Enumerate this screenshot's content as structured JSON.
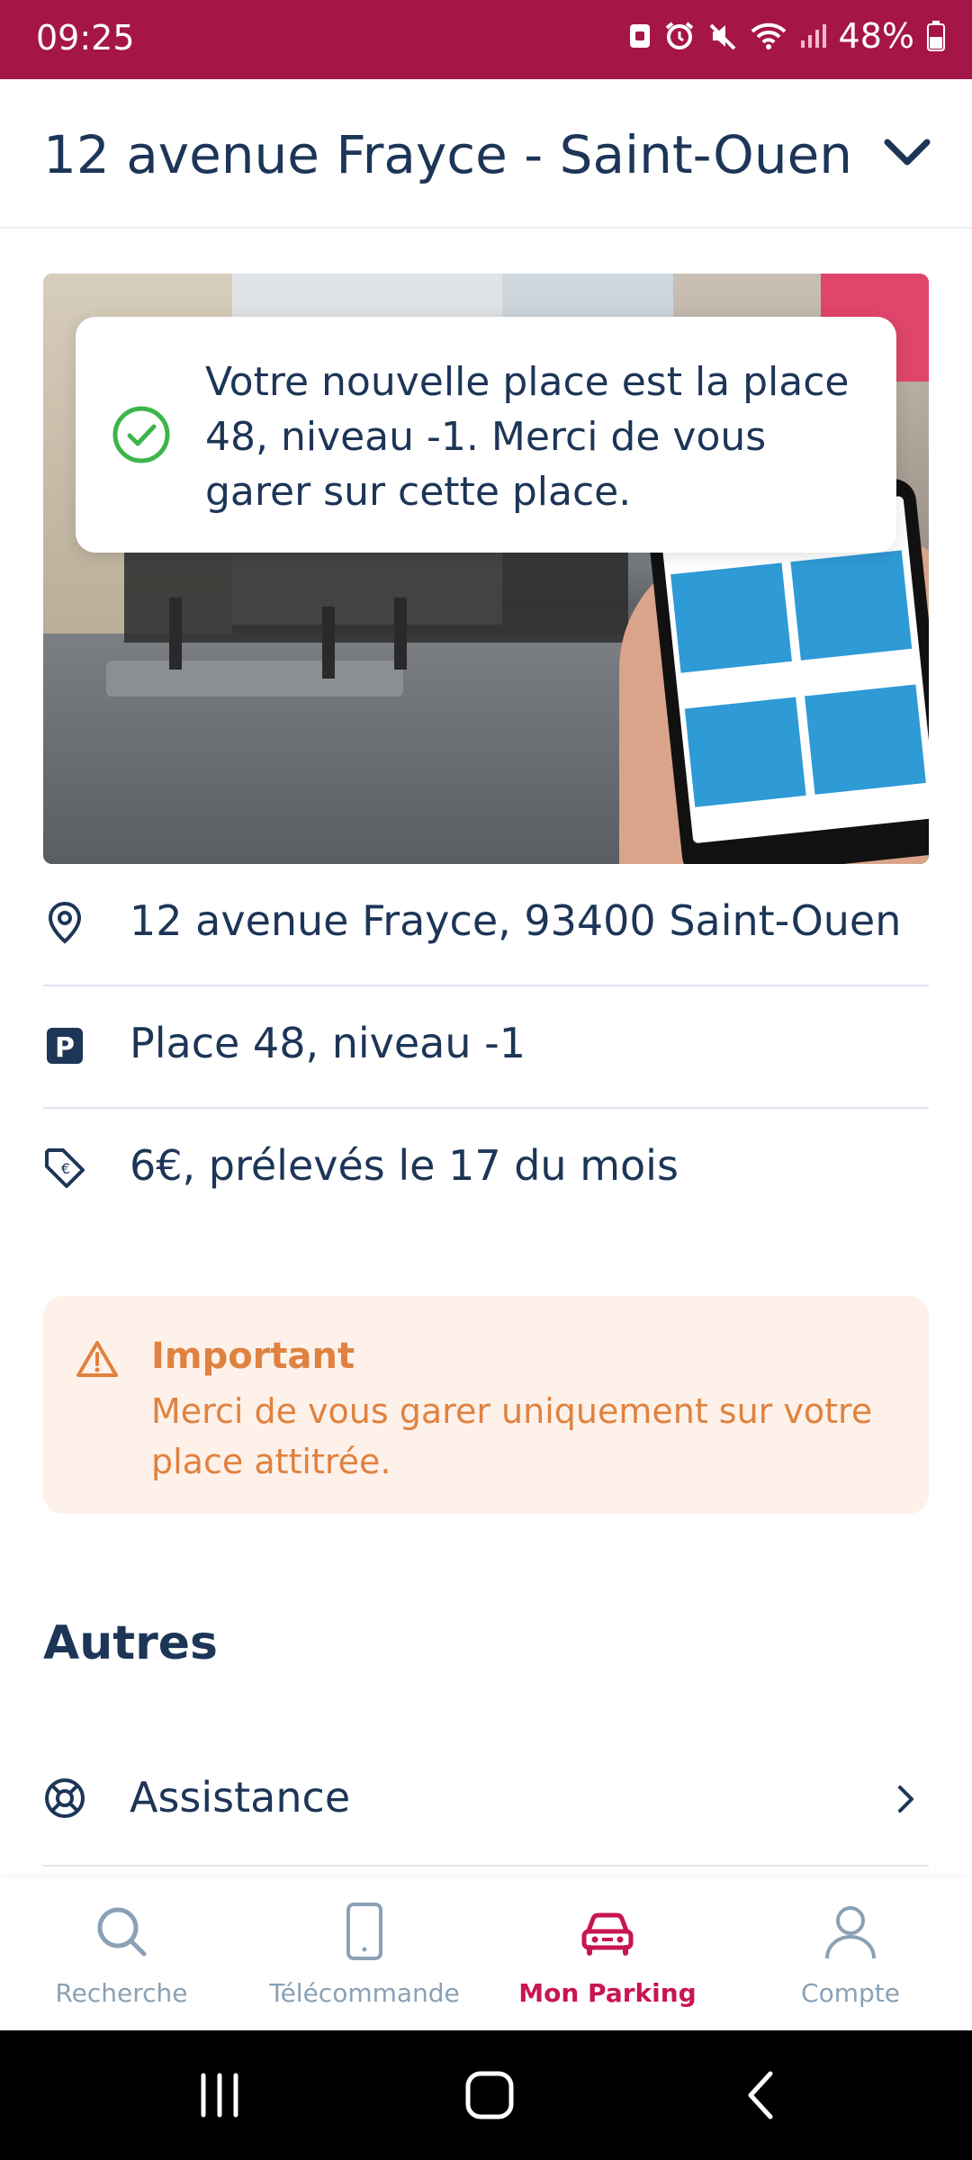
{
  "status_bar": {
    "time": "09:25",
    "battery": "48%",
    "icons": [
      "sim-icon",
      "alarm-icon",
      "mute-icon",
      "wifi-icon",
      "signal-icon",
      "battery-icon"
    ],
    "color": "#a51646"
  },
  "header": {
    "title": "12 avenue Frayce - Saint-Ouen",
    "dropdown_icon": "chevron-down-icon"
  },
  "toast": {
    "icon": "check-circle-icon",
    "message": "Votre nouvelle place est la place 48, niveau -1. Merci de vous garer sur cette place."
  },
  "details": [
    {
      "icon": "location-pin-icon",
      "text": "12 avenue Frayce, 93400 Saint-Ouen"
    },
    {
      "icon": "parking-icon",
      "text": "Place 48, niveau -1"
    },
    {
      "icon": "price-tag-icon",
      "text": "6€, prélevés le 17 du mois"
    }
  ],
  "important": {
    "icon": "warning-icon",
    "title": "Important",
    "body": "Merci de vous garer uniquement sur votre place attitrée."
  },
  "autres": {
    "title": "Autres",
    "items": [
      {
        "icon": "lifebuoy-icon",
        "label": "Assistance"
      }
    ]
  },
  "bottom_nav": {
    "items": [
      {
        "icon": "search-icon",
        "label": "Recherche",
        "active": false
      },
      {
        "icon": "remote-icon",
        "label": "Télécommande",
        "active": false
      },
      {
        "icon": "car-icon",
        "label": "Mon Parking",
        "active": true
      },
      {
        "icon": "user-icon",
        "label": "Compte",
        "active": false
      }
    ],
    "active_color": "#c8164f",
    "inactive_color": "#8aa1b6"
  },
  "colors": {
    "primary_text": "#1d3557",
    "success": "#3cb54a",
    "warning": "#e0823f",
    "warning_bg": "#fdf1ea"
  }
}
